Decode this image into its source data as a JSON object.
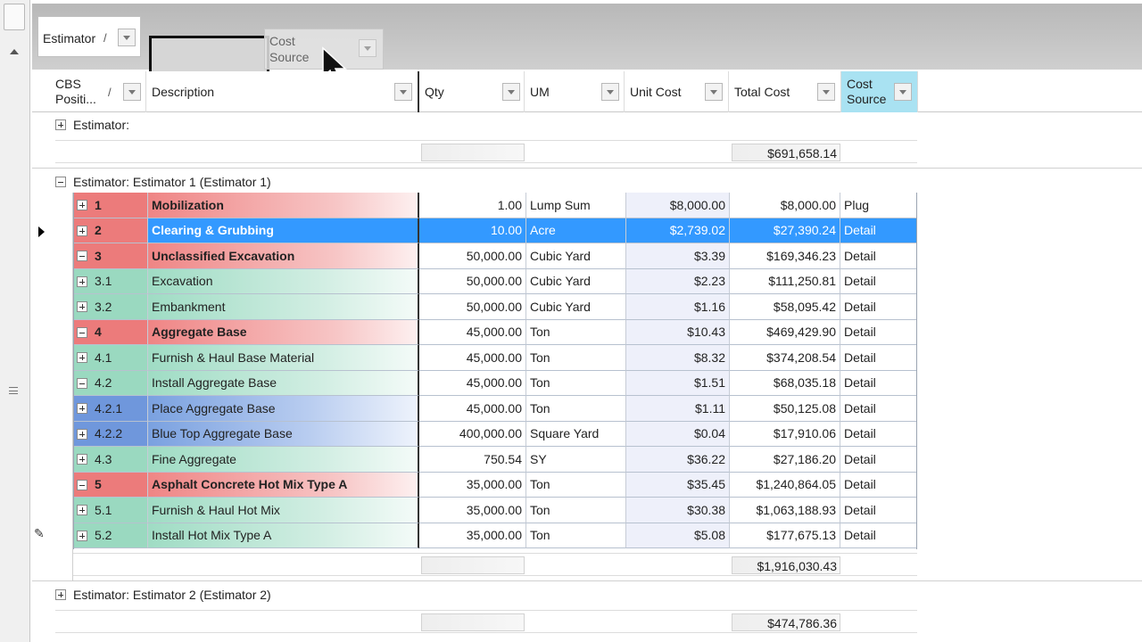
{
  "group_panel": {
    "chip_label": "Estimator",
    "chip_sort": "/",
    "ghost_label": "Cost Source"
  },
  "columns": {
    "cbs": "CBS Positi...",
    "cbs_sort": "/",
    "description": "Description",
    "qty": "Qty",
    "um": "UM",
    "unit_cost": "Unit Cost",
    "total_cost": "Total Cost",
    "cost_source": "Cost Source"
  },
  "groups": {
    "top_label": "Estimator:",
    "top_total": "$691,658.14",
    "est1_label": "Estimator: Estimator 1 (Estimator 1)",
    "est1_total": "$1,916,030.43",
    "est2_label": "Estimator: Estimator 2 (Estimator 2)",
    "est2_total": "$474,786.36"
  },
  "rows": [
    {
      "num": "1",
      "desc": "Mobilization",
      "qty": "1.00",
      "um": "Lump Sum",
      "unit": "$8,000.00",
      "total": "$8,000.00",
      "src": "Plug"
    },
    {
      "num": "2",
      "desc": "Clearing & Grubbing",
      "qty": "10.00",
      "um": "Acre",
      "unit": "$2,739.02",
      "total": "$27,390.24",
      "src": "Detail"
    },
    {
      "num": "3",
      "desc": "Unclassified Excavation",
      "qty": "50,000.00",
      "um": "Cubic Yard",
      "unit": "$3.39",
      "total": "$169,346.23",
      "src": "Detail"
    },
    {
      "num": "3.1",
      "desc": "Excavation",
      "qty": "50,000.00",
      "um": "Cubic Yard",
      "unit": "$2.23",
      "total": "$111,250.81",
      "src": "Detail"
    },
    {
      "num": "3.2",
      "desc": "Embankment",
      "qty": "50,000.00",
      "um": "Cubic Yard",
      "unit": "$1.16",
      "total": "$58,095.42",
      "src": "Detail"
    },
    {
      "num": "4",
      "desc": "Aggregate Base",
      "qty": "45,000.00",
      "um": "Ton",
      "unit": "$10.43",
      "total": "$469,429.90",
      "src": "Detail"
    },
    {
      "num": "4.1",
      "desc": "Furnish & Haul Base Material",
      "qty": "45,000.00",
      "um": "Ton",
      "unit": "$8.32",
      "total": "$374,208.54",
      "src": "Detail"
    },
    {
      "num": "4.2",
      "desc": "Install Aggregate Base",
      "qty": "45,000.00",
      "um": "Ton",
      "unit": "$1.51",
      "total": "$68,035.18",
      "src": "Detail"
    },
    {
      "num": "4.2.1",
      "desc": "Place Aggregate Base",
      "qty": "45,000.00",
      "um": "Ton",
      "unit": "$1.11",
      "total": "$50,125.08",
      "src": "Detail"
    },
    {
      "num": "4.2.2",
      "desc": "Blue Top Aggregate Base",
      "qty": "400,000.00",
      "um": "Square Yard",
      "unit": "$0.04",
      "total": "$17,910.06",
      "src": "Detail"
    },
    {
      "num": "4.3",
      "desc": "Fine Aggregate",
      "qty": "750.54",
      "um": "SY",
      "unit": "$36.22",
      "total": "$27,186.20",
      "src": "Detail"
    },
    {
      "num": "5",
      "desc": "Asphalt Concrete Hot Mix Type A",
      "qty": "35,000.00",
      "um": "Ton",
      "unit": "$35.45",
      "total": "$1,240,864.05",
      "src": "Detail"
    },
    {
      "num": "5.1",
      "desc": "Furnish & Haul Hot Mix",
      "qty": "35,000.00",
      "um": "Ton",
      "unit": "$30.38",
      "total": "$1,063,188.93",
      "src": "Detail"
    },
    {
      "num": "5.2",
      "desc": "Install Hot Mix Type A",
      "qty": "35,000.00",
      "um": "Ton",
      "unit": "$5.08",
      "total": "$177,675.13",
      "src": "Detail"
    }
  ],
  "colors": {
    "selection": "#3399ff",
    "parent_row": "#ec7b7b",
    "child_row": "#9ad9c0",
    "grandchild_row": "#6f97dc",
    "cost_source_header": "#a9e2f2"
  }
}
